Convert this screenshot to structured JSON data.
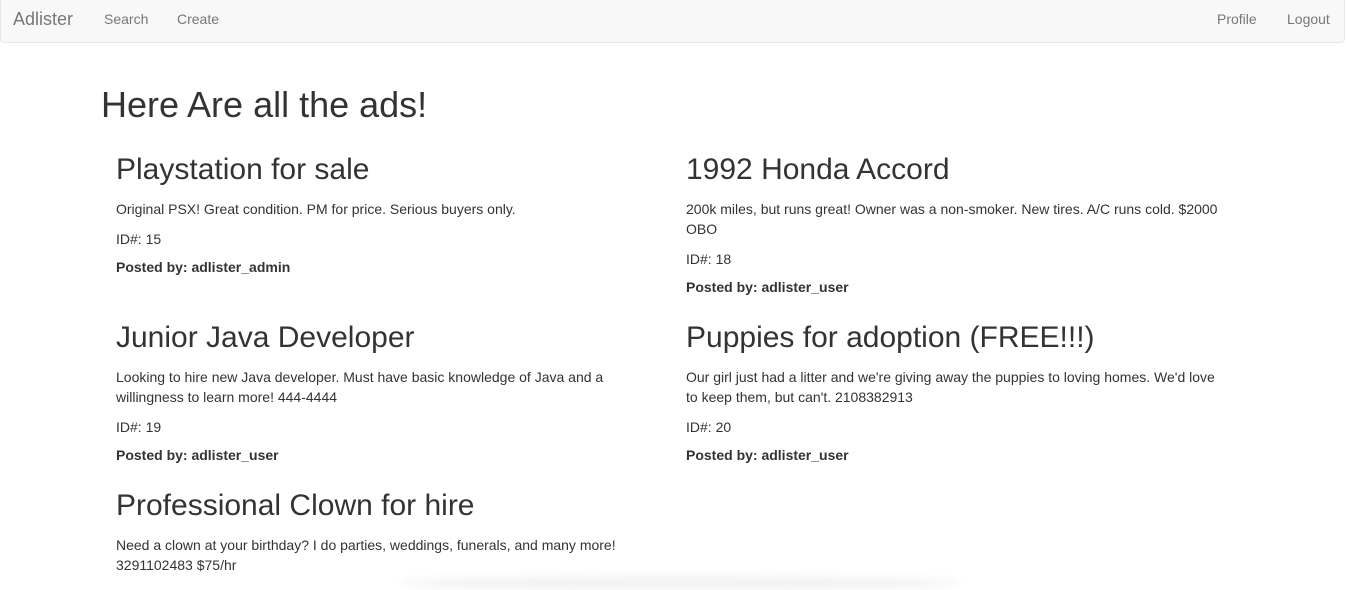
{
  "navbar": {
    "brand": "Adlister",
    "links_left": [
      "Search",
      "Create"
    ],
    "links_right": [
      "Profile",
      "Logout"
    ]
  },
  "page": {
    "heading": "Here Are all the ads!"
  },
  "ads": [
    {
      "title": "Playstation for sale",
      "description": "Original PSX! Great condition. PM for price. Serious buyers only.",
      "id_text": "ID#: 15",
      "posted_by": "Posted by: adlister_admin"
    },
    {
      "title": "1992 Honda Accord",
      "description": "200k miles, but runs great! Owner was a non-smoker. New tires. A/C runs cold. $2000 OBO",
      "id_text": "ID#: 18",
      "posted_by": "Posted by: adlister_user"
    },
    {
      "title": "Junior Java Developer",
      "description": "Looking to hire new Java developer. Must have basic knowledge of Java and a willingness to learn more! 444-4444",
      "id_text": "ID#: 19",
      "posted_by": "Posted by: adlister_user"
    },
    {
      "title": "Puppies for adoption (FREE!!!)",
      "description": "Our girl just had a litter and we're giving away the puppies to loving homes. We'd love to keep them, but can't. 2108382913",
      "id_text": "ID#: 20",
      "posted_by": "Posted by: adlister_user"
    },
    {
      "title": "Professional Clown for hire",
      "description": "Need a clown at your birthday? I do parties, weddings, funerals, and many more! 3291102483 $75/hr",
      "id_text": "",
      "posted_by": ""
    }
  ],
  "colors": {
    "navbar_bg": "#f8f8f8",
    "navbar_border": "#e7e7e7",
    "nav_link": "#777777",
    "text": "#333333"
  }
}
